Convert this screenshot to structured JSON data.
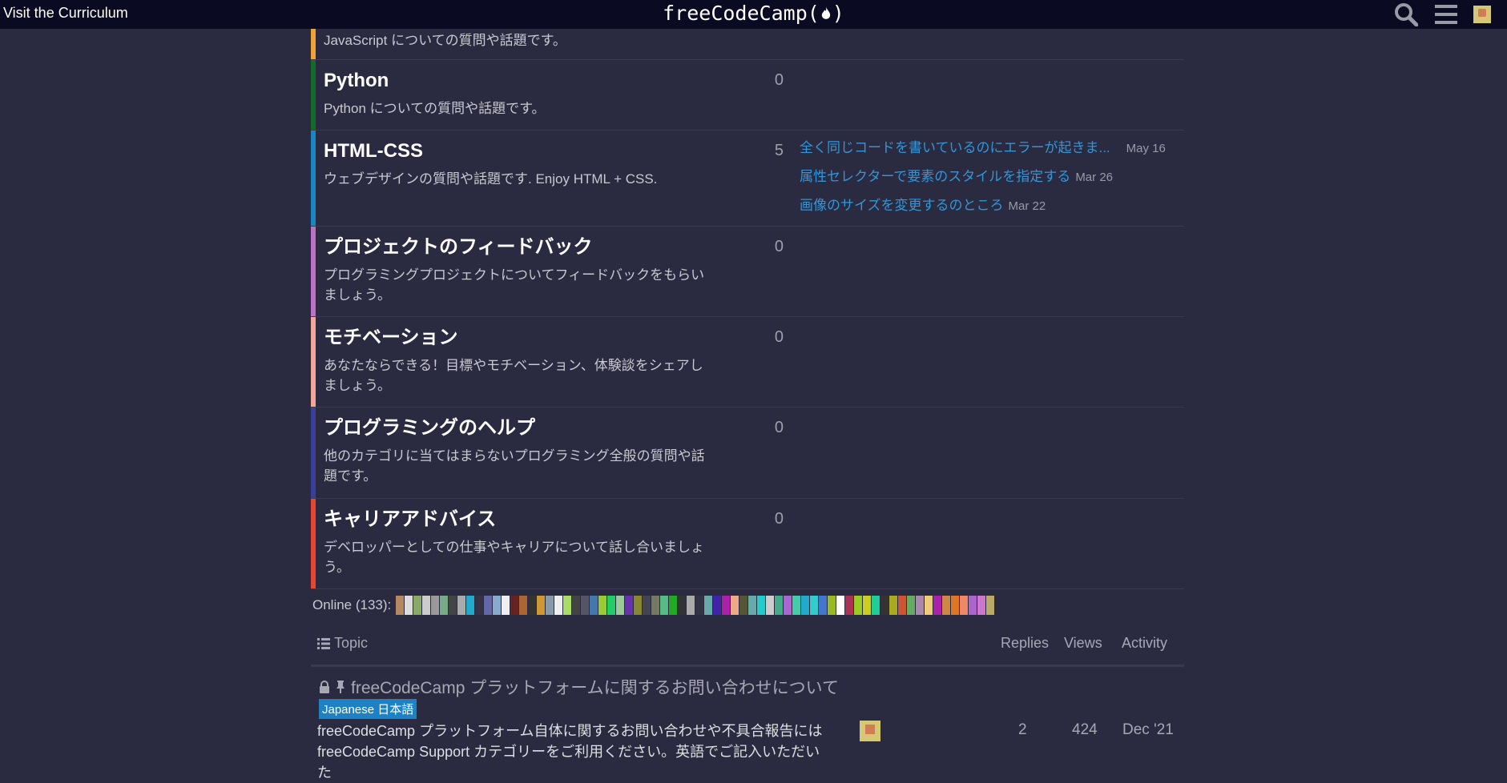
{
  "header": {
    "visit_label": "Visit the Curriculum",
    "logo_text": "freeCodeCamp(",
    "logo_suffix": ")"
  },
  "categories": [
    {
      "title": "",
      "desc": "JavaScript についての質問や話題です。",
      "count": "",
      "color": "#f1a238",
      "latest": []
    },
    {
      "title": "Python",
      "desc": "Python についての質問や話題です。",
      "count": "0",
      "color": "#126d2a",
      "latest": []
    },
    {
      "title": "HTML-CSS",
      "desc": "ウェブデザインの質問や話題です. Enjoy HTML + CSS.",
      "count": "5",
      "color": "#1c86c5",
      "latest": [
        {
          "title": "全く同じコードを書いているのにエラーが起きま...",
          "date": "May 16"
        },
        {
          "title": "属性セレクターで要素のスタイルを指定する",
          "date": "Mar 26"
        },
        {
          "title": "画像のサイズを変更するのところ",
          "date": "Mar 22"
        }
      ]
    },
    {
      "title": "プロジェクトのフィードバック",
      "desc": "プログラミングプロジェクトについてフィードバックをもらいましょう。",
      "count": "0",
      "color": "#bb74c5",
      "latest": []
    },
    {
      "title": "モチベーション",
      "desc": "あなたならできる！目標やモチベーション、体験談をシェアしましょう。",
      "count": "0",
      "color": "#f4a69b",
      "latest": []
    },
    {
      "title": "プログラミングのヘルプ",
      "desc": "他のカテゴリに当てはまらないプログラミング全般の質問や話題です。",
      "count": "0",
      "color": "#3b3f9c",
      "latest": []
    },
    {
      "title": "キャリアアドバイス",
      "desc": "デベロッパーとしての仕事やキャリアについて話し合いましょう。",
      "count": "0",
      "color": "#e84631",
      "latest": []
    }
  ],
  "online": {
    "label": "Online (133):",
    "avatar_colors": [
      "#b58863",
      "#ddd",
      "#8a6",
      "#ccc",
      "#999",
      "#7a8",
      "#444",
      "#aaa",
      "#2ac",
      "#334",
      "#66a",
      "#8ac",
      "#eee",
      "#622",
      "#a63",
      "#333",
      "#c93",
      "#89a",
      "#eee",
      "#ad6",
      "#444",
      "#556",
      "#47a",
      "#9c3",
      "#2c6",
      "#9c9",
      "#63a",
      "#883",
      "#445",
      "#776",
      "#5b8",
      "#2a2",
      "#333",
      "#aaa",
      "#334",
      "#6aa",
      "#42a",
      "#a2a",
      "#ea8",
      "#553",
      "#6aa",
      "#2cc",
      "#ccc",
      "#4a8",
      "#a6c",
      "#4ca",
      "#2ac",
      "#3cc",
      "#47c",
      "#9b2",
      "#fff",
      "#a35",
      "#9c2",
      "#cc2",
      "#2c9",
      "#333",
      "#aa2",
      "#c53",
      "#6a6",
      "#a8a",
      "#ec7",
      "#a2a",
      "#c84",
      "#d72",
      "#e86",
      "#a6c",
      "#c7c",
      "#ba6"
    ]
  },
  "table": {
    "topic_header": "Topic",
    "replies_header": "Replies",
    "views_header": "Views",
    "activity_header": "Activity"
  },
  "topic": {
    "title": "freeCodeCamp プラットフォームに関するお問い合わせについて",
    "tag": "Japanese 日本語",
    "excerpt_line1": "freeCodeCamp プラットフォーム自体に関するお問い合わせや不具合報告には",
    "excerpt_line2": "freeCodeCamp Support カテゴリーをご利用ください。英語でご記入いただいた",
    "replies": "2",
    "views": "424",
    "activity": "Dec '21"
  }
}
